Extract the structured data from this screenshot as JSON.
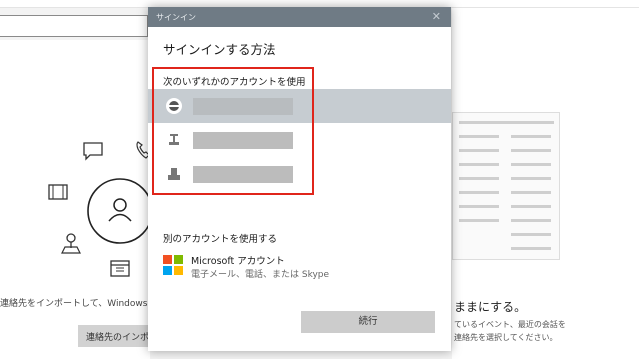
{
  "dialog": {
    "titlebar_label": "サインイン",
    "close_glyph": "✕",
    "heading": "サインインする方法",
    "section_label": "次のいずれかのアカウントを使用",
    "other_label": "別のアカウントを使用する",
    "ms_account": {
      "title": "Microsoft アカウント",
      "subtitle": "電子メール、電話、または Skype"
    },
    "continue_label": "続行"
  },
  "background": {
    "import_hint": "連絡先をインポートして、Windows 全体",
    "import_button": "連絡先のインポー",
    "right_heading": "ままにする。",
    "right_line1": "ているイベント、最近の会話を",
    "right_line2": "連絡先を選択してください。"
  },
  "colors": {
    "highlight_box": "#e0251b",
    "selected_row": "#c6ccd1",
    "titlebar": "#6f7b85"
  },
  "icons": {
    "chat": "chat-bubble-icon",
    "phone": "phone-icon",
    "film": "film-icon",
    "contact": "person-icon",
    "map": "map-pin-icon",
    "calendar": "calendar-icon"
  }
}
